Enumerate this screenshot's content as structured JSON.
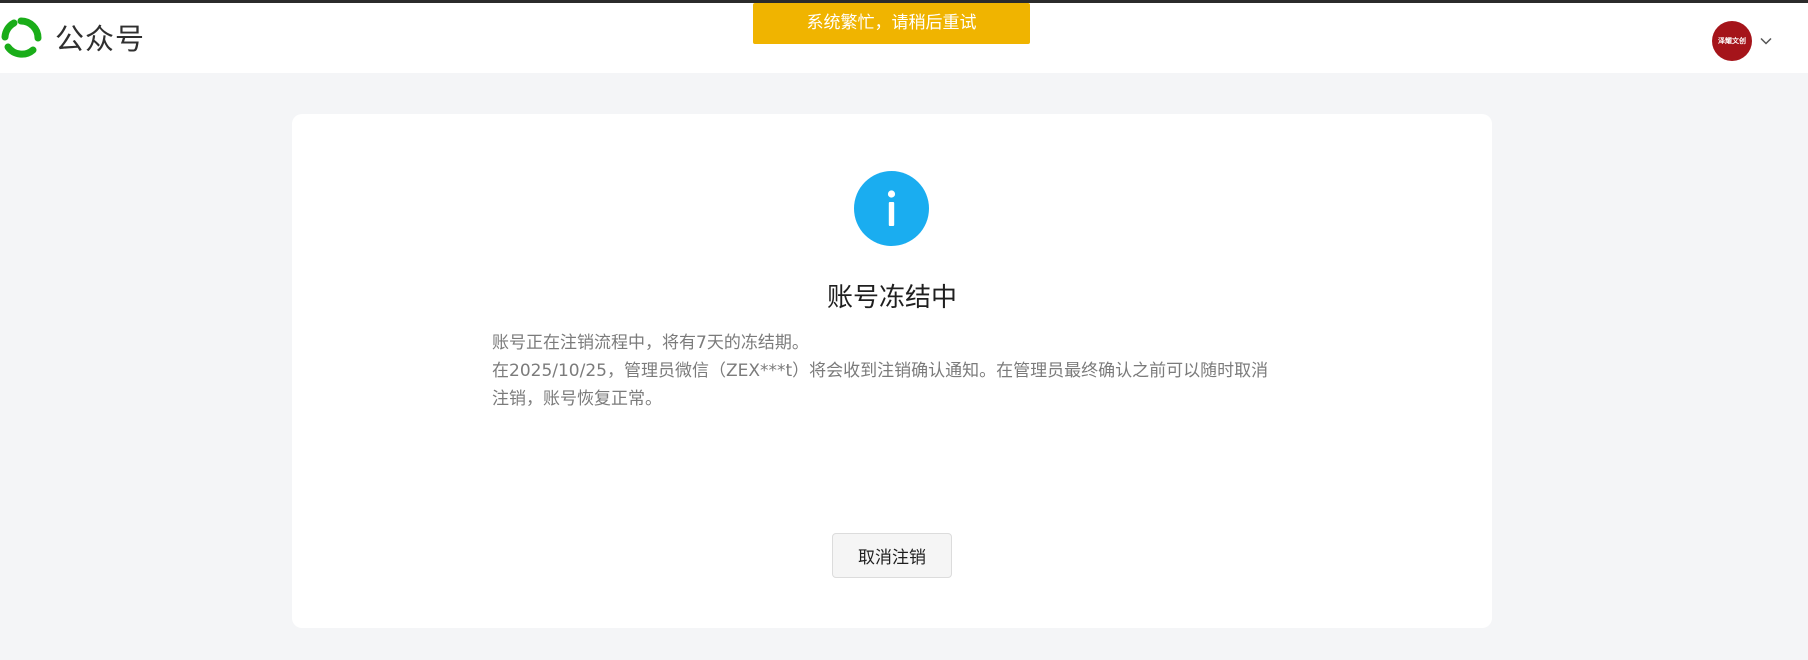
{
  "header": {
    "brand_name": "公众号",
    "logo_icon": "wechat-official-account-logo-icon",
    "avatar_text": "泽耀文创",
    "avatar_color": "#a5141a",
    "dropdown_icon": "chevron-down-icon"
  },
  "toast": {
    "message": "系统繁忙，请稍后重试",
    "color": "#f0b400"
  },
  "main": {
    "status_icon": "info-icon",
    "status_icon_color": "#1aadf0",
    "title": "账号冻结中",
    "description_line1": "账号正在注销流程中，将有7天的冻结期。",
    "description_line2": "在2025/10/25，管理员微信（ZEX***t）将会收到注销确认通知。在管理员最终确认之前可以随时取消注销，账号恢复正常。",
    "cancel_button_label": "取消注销"
  }
}
